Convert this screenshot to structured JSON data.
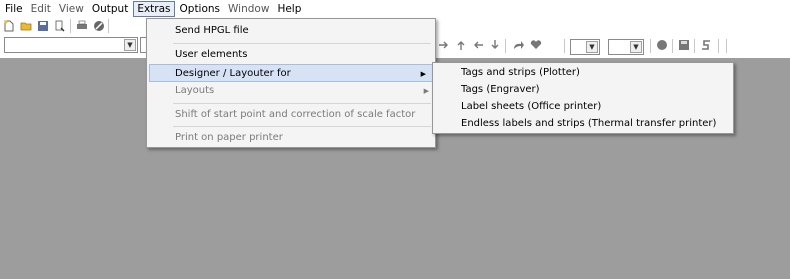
{
  "menubar": {
    "items": [
      {
        "label": "File",
        "state": "normal"
      },
      {
        "label": "Edit",
        "state": "disabled"
      },
      {
        "label": "View",
        "state": "disabled"
      },
      {
        "label": "Output",
        "state": "normal"
      },
      {
        "label": "Extras",
        "state": "active"
      },
      {
        "label": "Options",
        "state": "normal"
      },
      {
        "label": "Window",
        "state": "disabled"
      },
      {
        "label": "Help",
        "state": "normal"
      }
    ]
  },
  "extras_menu": {
    "items": [
      {
        "label": "Send HPGL file",
        "state": "normal"
      },
      {
        "label": "User elements",
        "state": "normal"
      },
      {
        "label": "Designer / Layouter for",
        "state": "highlight",
        "submenu": true
      },
      {
        "label": "Layouts",
        "state": "disabled",
        "submenu": true
      },
      {
        "label": "Shift of start point and correction of scale factor",
        "state": "disabled"
      },
      {
        "label": "Print on paper printer",
        "state": "disabled"
      }
    ]
  },
  "designer_submenu": {
    "items": [
      {
        "label": "Tags and strips (Plotter)"
      },
      {
        "label": "Tags (Engraver)"
      },
      {
        "label": "Label sheets (Office printer)"
      },
      {
        "label": "Endless labels and strips (Thermal transfer printer)"
      }
    ]
  },
  "toolbar": {
    "icons": [
      "new-file-icon",
      "open-folder-icon",
      "save-icon",
      "print-preview-icon",
      "print-icon",
      "stop-icon"
    ],
    "nav_icons": [
      "arrow-right-icon",
      "arrow-up-icon",
      "arrow-left-icon",
      "arrow-down-icon",
      "redo-icon",
      "heart-icon",
      "record-icon",
      "save-disk-icon",
      "undo-icon"
    ]
  },
  "colors": {
    "workspace": "#9d9d9d",
    "menu_bg": "#f4f4f4",
    "highlight": "#d7e3f5"
  }
}
